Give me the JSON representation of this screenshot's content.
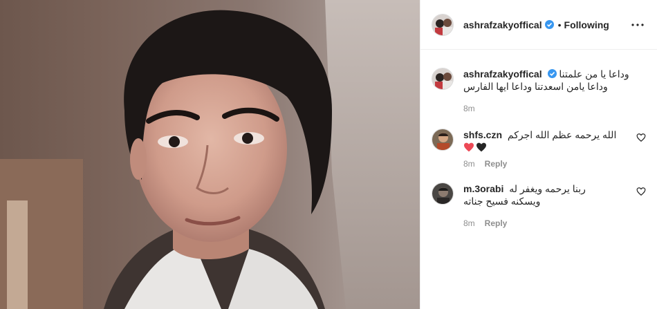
{
  "post": {
    "author": "ashrafzakyoffical",
    "follow_status": "Following",
    "separator": "•"
  },
  "caption": {
    "username": "ashrafzakyoffical",
    "line1": "وداعا يا من علمتنا",
    "line2": "وداعا يامن اسعدتنا وداعا ايها الفارس",
    "time": "8m"
  },
  "comments": [
    {
      "username": "shfs.czn",
      "text": "الله يرحمه عظم الله اجركم",
      "emojis": [
        "red-heart",
        "black-heart"
      ],
      "time": "8m",
      "reply_label": "Reply"
    },
    {
      "username": "m.3orabi",
      "line1": "ربنا يرحمه ويغفر له",
      "line2": "ويسكنه فسيح جناته",
      "time": "8m",
      "reply_label": "Reply"
    }
  ],
  "colors": {
    "verified": "#3897f0",
    "heart_red": "#ed4956",
    "text": "#262626",
    "muted": "#8e8e8e"
  }
}
